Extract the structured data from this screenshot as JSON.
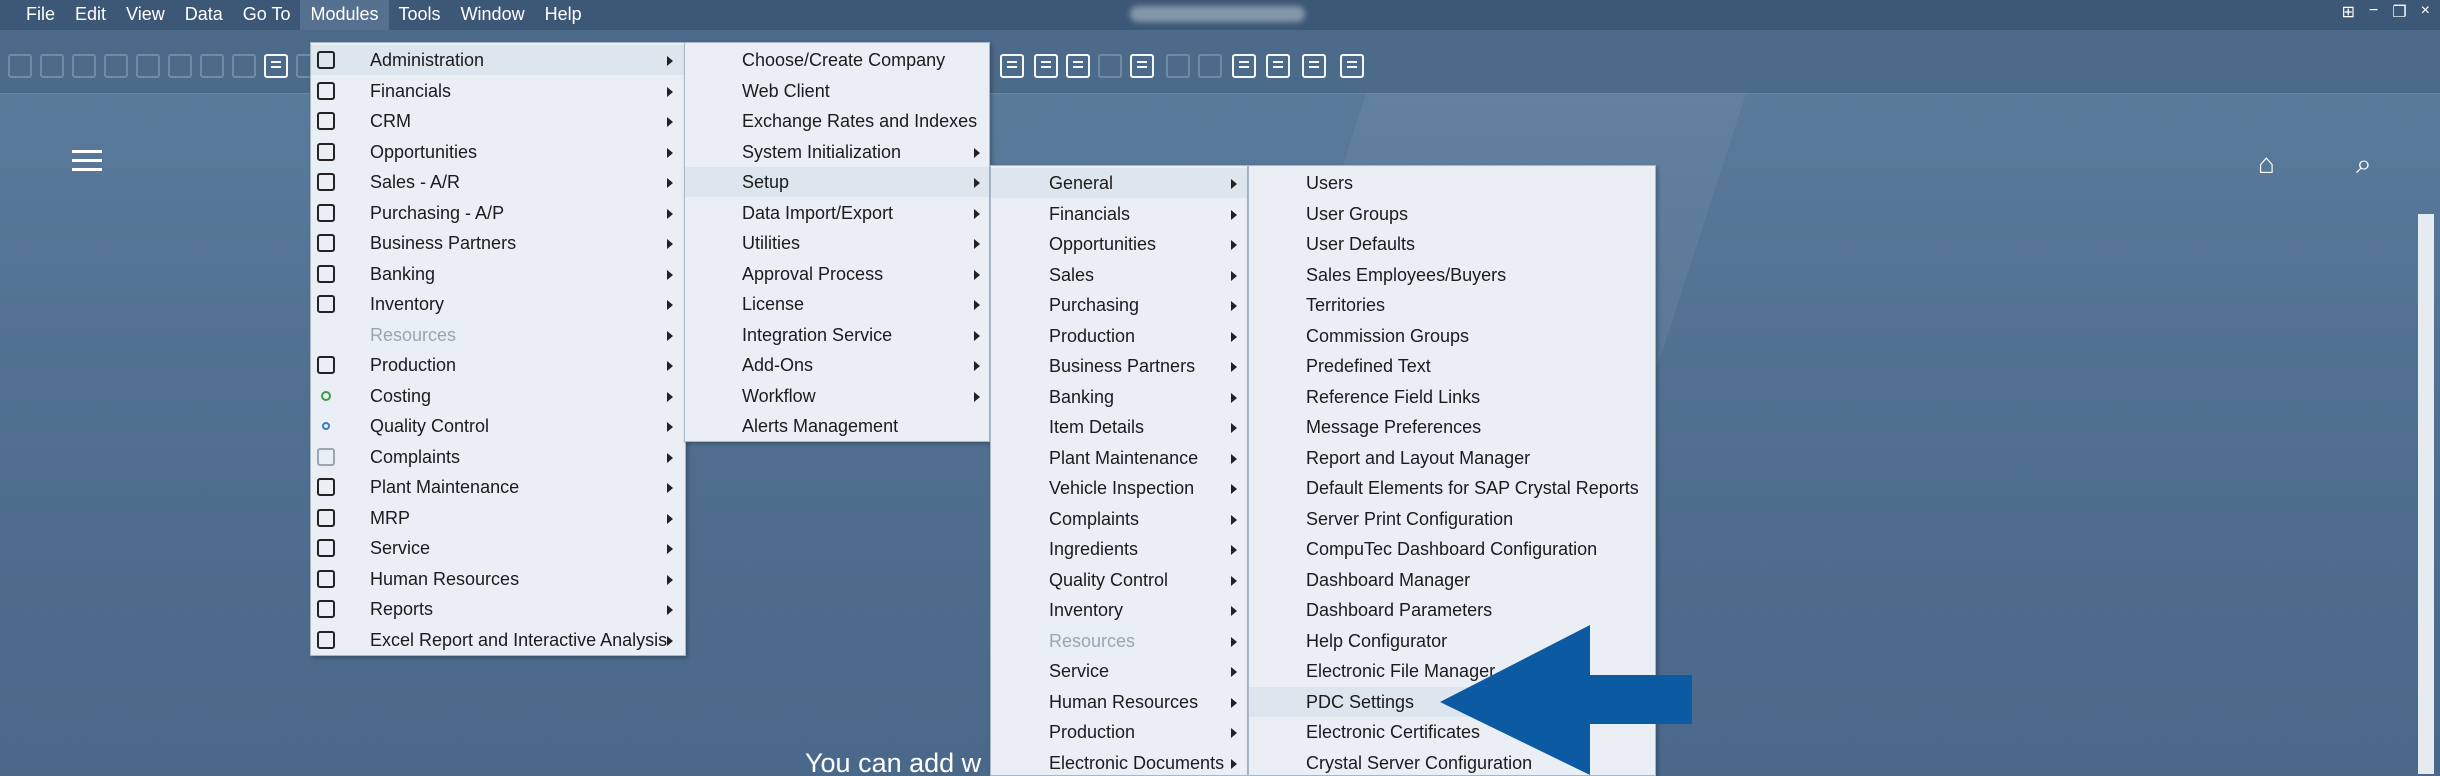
{
  "menubar": {
    "items": [
      "File",
      "Edit",
      "View",
      "Data",
      "Go To",
      "Modules",
      "Tools",
      "Window",
      "Help"
    ]
  },
  "main": {
    "background_text": "You can add w"
  },
  "modules_menu": [
    {
      "label": "Administration",
      "icon": "gears-icon",
      "submenu": true
    },
    {
      "label": "Financials",
      "icon": "ledger-icon",
      "submenu": true
    },
    {
      "label": "CRM",
      "icon": "crm-icon",
      "submenu": true
    },
    {
      "label": "Opportunities",
      "icon": "chart-icon",
      "submenu": true
    },
    {
      "label": "Sales - A/R",
      "icon": "dollar-icon",
      "submenu": true
    },
    {
      "label": "Purchasing - A/P",
      "icon": "cart-icon",
      "submenu": true
    },
    {
      "label": "Business Partners",
      "icon": "partners-icon",
      "submenu": true
    },
    {
      "label": "Banking",
      "icon": "moneybag-icon",
      "submenu": true
    },
    {
      "label": "Inventory",
      "icon": "inventory-icon",
      "submenu": true
    },
    {
      "label": "Resources",
      "icon": "none",
      "submenu": true,
      "disabled": true
    },
    {
      "label": "Production",
      "icon": "box-icon",
      "submenu": true
    },
    {
      "label": "Costing",
      "icon": "costing-icon",
      "submenu": true
    },
    {
      "label": "Quality Control",
      "icon": "pin-icon",
      "submenu": true
    },
    {
      "label": "Complaints",
      "icon": "clipboard-icon",
      "submenu": true
    },
    {
      "label": "Plant Maintenance",
      "icon": "tools-icon",
      "submenu": true
    },
    {
      "label": "MRP",
      "icon": "calendar-icon",
      "submenu": true
    },
    {
      "label": "Service",
      "icon": "building-icon",
      "submenu": true
    },
    {
      "label": "Human Resources",
      "icon": "person-icon",
      "submenu": true
    },
    {
      "label": "Reports",
      "icon": "report-icon",
      "submenu": true
    },
    {
      "label": "Excel Report and Interactive Analysis",
      "icon": "excel-icon",
      "submenu": true
    }
  ],
  "administration_menu": [
    {
      "label": "Choose/Create Company",
      "submenu": false
    },
    {
      "label": "Web Client",
      "submenu": false
    },
    {
      "label": "Exchange Rates and Indexes",
      "submenu": false
    },
    {
      "label": "System Initialization",
      "submenu": true
    },
    {
      "label": "Setup",
      "submenu": true
    },
    {
      "label": "Data Import/Export",
      "submenu": true
    },
    {
      "label": "Utilities",
      "submenu": true
    },
    {
      "label": "Approval Process",
      "submenu": true
    },
    {
      "label": "License",
      "submenu": true
    },
    {
      "label": "Integration Service",
      "submenu": true
    },
    {
      "label": "Add-Ons",
      "submenu": true
    },
    {
      "label": "Workflow",
      "submenu": true
    },
    {
      "label": "Alerts Management",
      "submenu": false
    }
  ],
  "setup_menu": [
    {
      "label": "General",
      "submenu": true
    },
    {
      "label": "Financials",
      "submenu": true
    },
    {
      "label": "Opportunities",
      "submenu": true
    },
    {
      "label": "Sales",
      "submenu": true
    },
    {
      "label": "Purchasing",
      "submenu": true
    },
    {
      "label": "Production",
      "submenu": true
    },
    {
      "label": "Business Partners",
      "submenu": true
    },
    {
      "label": "Banking",
      "submenu": true
    },
    {
      "label": "Item Details",
      "submenu": true
    },
    {
      "label": "Plant Maintenance",
      "submenu": true
    },
    {
      "label": "Vehicle Inspection",
      "submenu": true
    },
    {
      "label": "Complaints",
      "submenu": true
    },
    {
      "label": "Ingredients",
      "submenu": true
    },
    {
      "label": "Quality Control",
      "submenu": true
    },
    {
      "label": "Inventory",
      "submenu": true
    },
    {
      "label": "Resources",
      "submenu": true,
      "disabled": true
    },
    {
      "label": "Service",
      "submenu": true
    },
    {
      "label": "Human Resources",
      "submenu": true
    },
    {
      "label": "Production",
      "submenu": true
    },
    {
      "label": "Electronic Documents",
      "submenu": true
    }
  ],
  "general_menu": [
    {
      "label": "Users"
    },
    {
      "label": "User Groups"
    },
    {
      "label": "User Defaults"
    },
    {
      "label": "Sales Employees/Buyers"
    },
    {
      "label": "Territories"
    },
    {
      "label": "Commission Groups"
    },
    {
      "label": "Predefined Text"
    },
    {
      "label": "Reference Field Links"
    },
    {
      "label": "Message Preferences"
    },
    {
      "label": "Report and Layout Manager"
    },
    {
      "label": "Default Elements for SAP Crystal Reports"
    },
    {
      "label": "Server Print Configuration"
    },
    {
      "label": "CompuTec Dashboard Configuration"
    },
    {
      "label": "Dashboard Manager"
    },
    {
      "label": "Dashboard Parameters"
    },
    {
      "label": "Help Configurator"
    },
    {
      "label": "Electronic File Manager"
    },
    {
      "label": "PDC Settings"
    },
    {
      "label": "Electronic Certificates"
    },
    {
      "label": "Crystal Server Configuration"
    }
  ],
  "colors": {
    "background": "#4f6e8f",
    "menubar": "#3d5876",
    "menu_bg": "#e9eff5",
    "highlight": "#dde5ee",
    "pointer_arrow": "#0b5aa2"
  }
}
